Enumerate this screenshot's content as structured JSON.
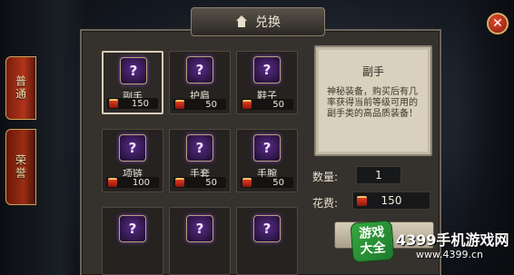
{
  "header": {
    "title": "兑换"
  },
  "tabs": [
    {
      "label": "普通"
    },
    {
      "label": "荣誉"
    }
  ],
  "items": [
    {
      "name": "副手",
      "price": "150",
      "selected": true
    },
    {
      "name": "护肩",
      "price": "50"
    },
    {
      "name": "鞋子",
      "price": "50"
    },
    {
      "name": "项链",
      "price": "100"
    },
    {
      "name": "手套",
      "price": "50"
    },
    {
      "name": "手腕",
      "price": "50"
    },
    {
      "name": ""
    },
    {
      "name": ""
    },
    {
      "name": ""
    }
  ],
  "detail": {
    "title": "副手",
    "description": "神秘装备，购买后有几率获得当前等级可用的副手类的高品质装备！"
  },
  "quantity": {
    "label": "数量:",
    "value": "1"
  },
  "cost": {
    "label": "花费:",
    "value": "150"
  },
  "watermark": {
    "badge_line1": "游戏",
    "badge_line2": "大全",
    "title": "4399手机游戏网",
    "url": "www.4399.cn"
  },
  "icons": {
    "item_slot": "mystery-equipment-icon",
    "price": "red-crystal-currency-icon",
    "home": "home-icon",
    "close": "close-icon"
  },
  "colors": {
    "panel": "#35312c",
    "tab_red": "#b0341a",
    "item_purple": "#5b2b8a",
    "detail_parchment": "#d9d0bd",
    "watermark_green": "#36a83f"
  }
}
